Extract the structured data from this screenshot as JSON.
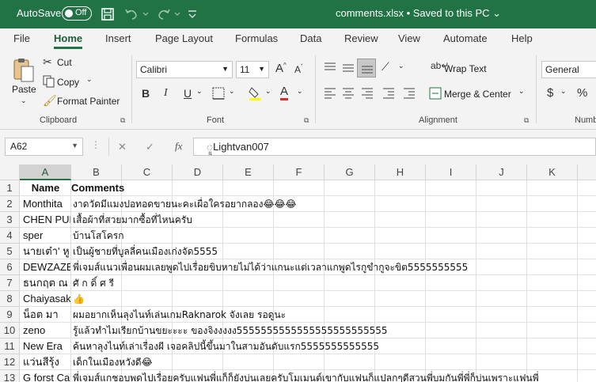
{
  "titlebar": {
    "autosave_label": "AutoSave",
    "autosave_state": "Off",
    "filename": "comments.xlsx • Saved to this PC ⌄"
  },
  "tabs": [
    "File",
    "Home",
    "Insert",
    "Page Layout",
    "Formulas",
    "Data",
    "Review",
    "View",
    "Automate",
    "Help"
  ],
  "active_tab": "Home",
  "ribbon": {
    "clipboard": {
      "paste": "Paste",
      "cut": "Cut",
      "copy": "Copy",
      "format_painter": "Format Painter",
      "label": "Clipboard"
    },
    "font": {
      "name": "Calibri",
      "size": "11",
      "label": "Font"
    },
    "alignment": {
      "wrap_text": "Wrap Text",
      "merge_center": "Merge & Center",
      "label": "Alignment"
    },
    "number": {
      "format": "General",
      "label": "Numb",
      "currency": "$",
      "percent": "%"
    }
  },
  "formula_bar": {
    "name_box": "A62",
    "formula": "ူLightvan007"
  },
  "columns": [
    "A",
    "B",
    "C",
    "D",
    "E",
    "F",
    "G",
    "H",
    "I",
    "J",
    "K"
  ],
  "selected_column": "A",
  "rows": [
    {
      "num": "1",
      "a": "Name",
      "b": "Comments"
    },
    {
      "num": "2",
      "a": "Monthita",
      "b": "งาดวัดมีแมงปอทอดขายนะคะเผื่อใครอยากลอง😂😂😂"
    },
    {
      "num": "3",
      "a": "CHEN PUN",
      "b": "เสื้อผ้าที่สวยมากซื้อที่ไหนครับ"
    },
    {
      "num": "4",
      "a": "sper",
      "b": "บ้านโสโครก"
    },
    {
      "num": "5",
      "a": "นายเต๋า' หู",
      "b": "เป็นผู้ชายที่บูลลี่คนเมืองเก่งจัด5555"
    },
    {
      "num": "6",
      "a": "DEWZAZE",
      "b": "พี่เจมส์แนวเพื่อนผมเลยพูดไปเรื่อยขิบหายไม่ได้ว่าแกนะแต่เวลาแกพูดไรกูขำกูจะขิต5555555555"
    },
    {
      "num": "7",
      "a": "ธนกฤต ณ",
      "b": "ศั ก ดิ์ ศ รี"
    },
    {
      "num": "8",
      "a": "Chaiyasak",
      "b": "👍"
    },
    {
      "num": "9",
      "a": "น็อต มา",
      "b": "ผมอยากเห็นลุงไนท์เล่นเกมRaknarok จังเลย รอดูนะ"
    },
    {
      "num": "10",
      "a": "zeno",
      "b": "รู้แล้วทำไมเรียกบ้านขยะะะะ ของจิงงงงง5555555555555555555555555"
    },
    {
      "num": "11",
      "a": "New Era",
      "b": "ค้นหาลุงไนท์เล่าเรื่องผี เจอคลิปนี้ขึ้นมาในสามอันดับแรก5555555555555"
    },
    {
      "num": "12",
      "a": "แว่นสีรุ้ง",
      "b": "เด็กในเมืองหวังดี😂"
    },
    {
      "num": "13",
      "a": "G forst Ca",
      "b": "พี่เจมส์แกชอบพดไปเรื่อยครับแฟนพี่แก็ก็ยังบ่นเลยครับโมเมนต์เขากับแฟนก็แปลกๆดีสวนพี่บมกันพี่พี่ก็บ่นเพราะแฟนพี่"
    }
  ]
}
